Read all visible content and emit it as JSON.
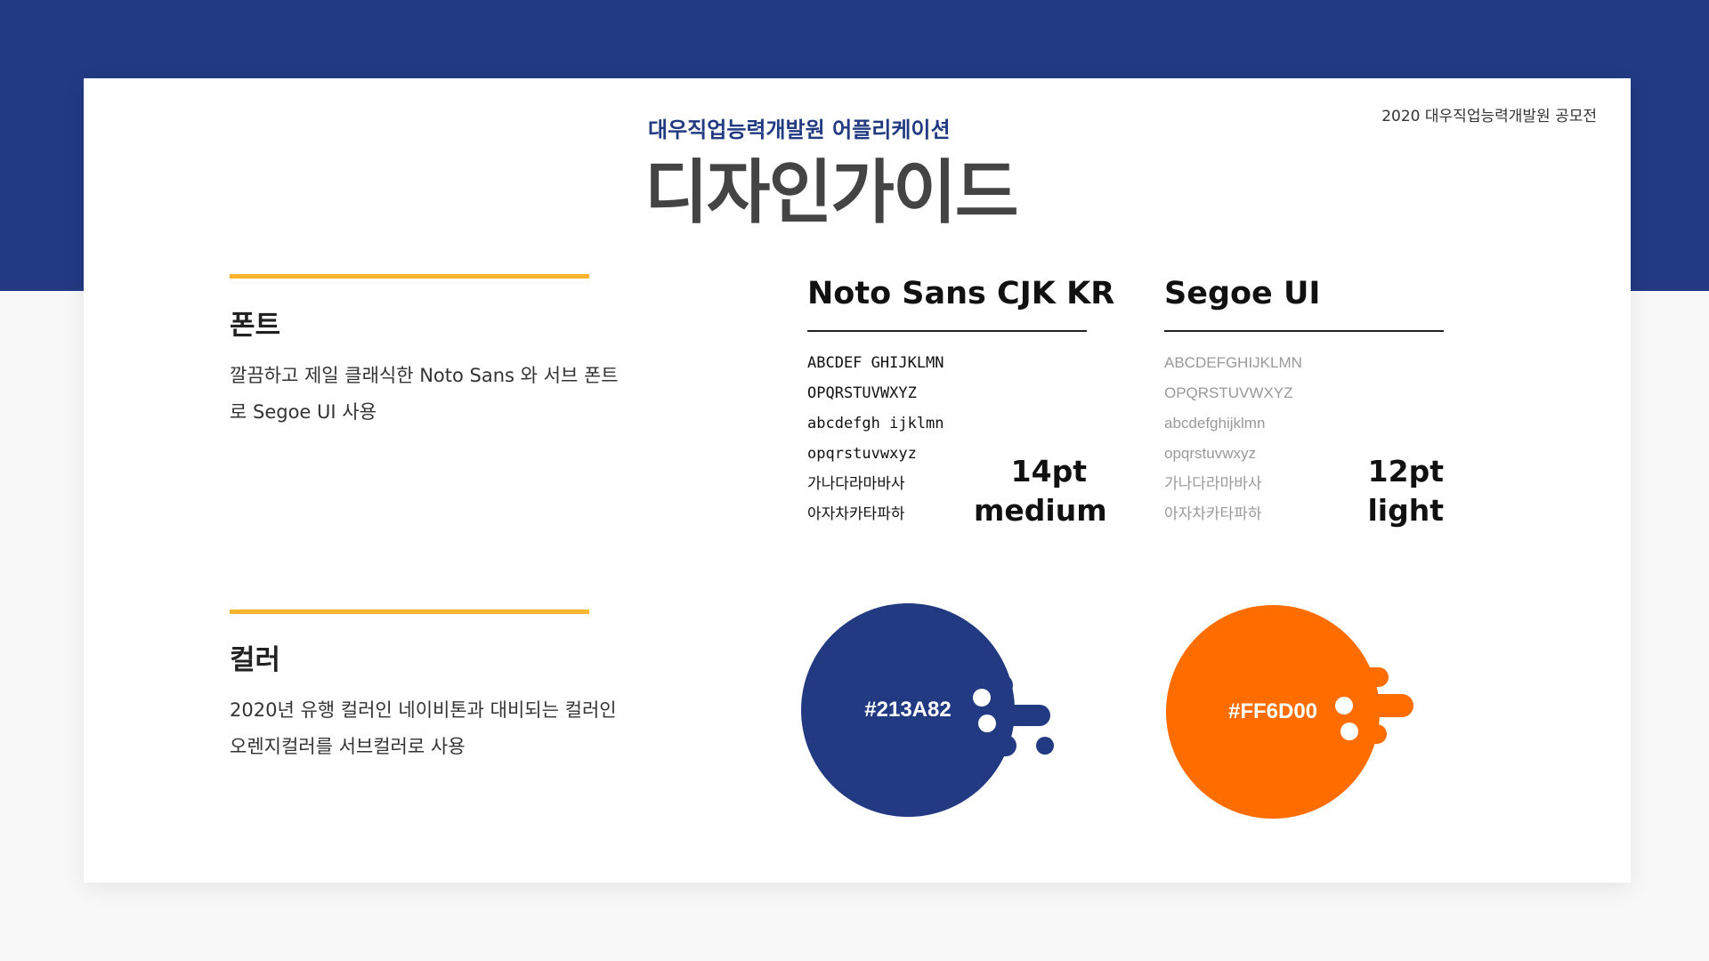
{
  "header": {
    "contest": "2020 대우직업능력개발원 공모전",
    "subtitle": "대우직업능력개발원 어플리케이션",
    "title": "디자인가이드"
  },
  "sections": {
    "font": {
      "heading": "폰트",
      "description": "깔끔하고 제일 클래식한 Noto Sans 와 서브 폰트로 Segoe UI 사용"
    },
    "color": {
      "heading": "컬러",
      "description": "2020년 유행 컬러인 네이비톤과 대비되는 컬러인 오렌지컬러를 서브컬러로 사용"
    }
  },
  "fonts": [
    {
      "name": "Noto Sans CJK KR",
      "samples": [
        "ABCDEF GHIJKLMN",
        "OPQRSTUVWXYZ",
        "abcdefgh ijklmn",
        "opqrstuvwxyz",
        "가나다라마바사",
        "아자차카타파하"
      ],
      "size": "14pt",
      "weight": "medium"
    },
    {
      "name": "Segoe UI",
      "samples": [
        "ABCDEFGHIJKLMN",
        "OPQRSTUVWXYZ",
        "abcdefghijklmn",
        "opqrstuvwxyz",
        "가나다라마바사",
        "아자차카타파하"
      ],
      "size": "12pt",
      "weight": "light"
    }
  ],
  "colors": [
    {
      "hex": "#213A82",
      "value": "#213a82"
    },
    {
      "hex": "#FF6D00",
      "value": "#ff6d00"
    }
  ],
  "accent": "#fbb52c"
}
